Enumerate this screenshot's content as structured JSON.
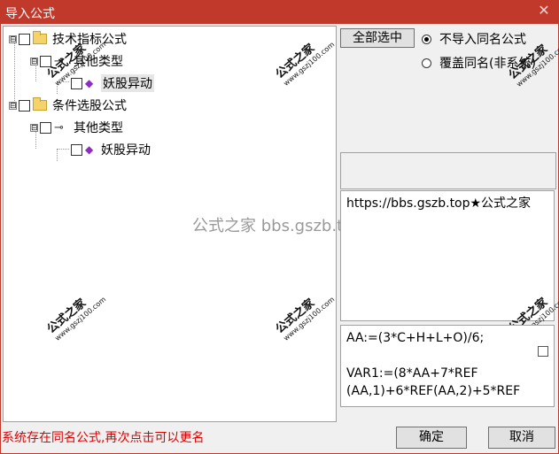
{
  "window": {
    "title": "导入公式",
    "close_glyph": "✕"
  },
  "tree": {
    "nodes": [
      {
        "label": "技术指标公式",
        "expander": "⊟"
      },
      {
        "label": "其他类型",
        "expander": "⊟"
      },
      {
        "label": "妖股异动"
      },
      {
        "label": "条件选股公式",
        "expander": "⊟"
      },
      {
        "label": "其他类型",
        "expander": "⊟"
      },
      {
        "label": "妖股异动"
      }
    ]
  },
  "watermarks": {
    "brand": "公式之家",
    "url": "www.gszj100.com",
    "center": "公式之家 bbs.gszb.top"
  },
  "right_panel": {
    "select_all_label": "全部选中",
    "option_skip_label": "不导入同名公式",
    "option_overwrite_label": "覆盖同名(非系统)",
    "selected_option": "option_skip",
    "url_text": "https://bbs.gszb.top★公式之家",
    "formula_lines": [
      "AA:=(3*C+H+L+O)/6;",
      "",
      "VAR1:=(8*AA+7*REF",
      "(AA,1)+6*REF(AA,2)+5*REF"
    ]
  },
  "footer": {
    "status_text": "系统存在同名公式,再次点击可以更名",
    "ok_label": "确定",
    "cancel_label": "取消"
  }
}
